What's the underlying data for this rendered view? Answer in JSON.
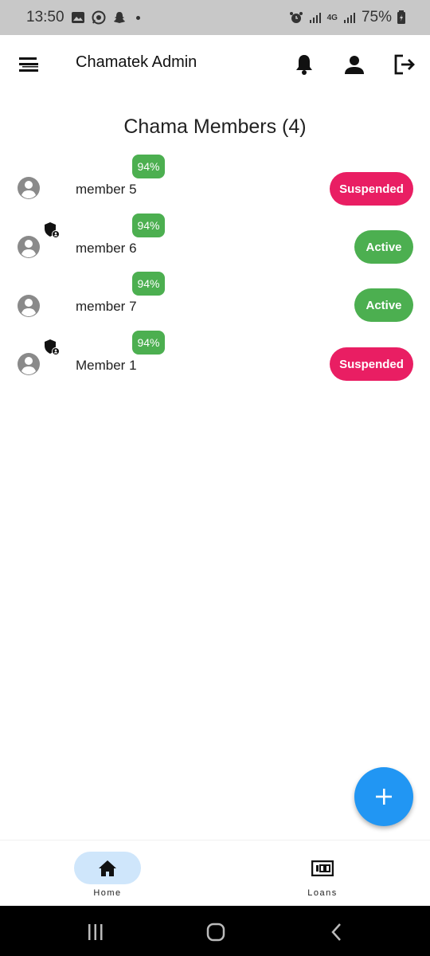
{
  "status_bar": {
    "time": "13:50",
    "battery": "75%",
    "network": "4G"
  },
  "app_bar": {
    "title": "Chamatek Admin",
    "actions": [
      "notifications-icon",
      "profile-icon",
      "logout-icon"
    ]
  },
  "page": {
    "heading": "Chama Members (4)"
  },
  "members": [
    {
      "name": "member 5",
      "score": "94%",
      "status": "Suspended",
      "is_admin": false
    },
    {
      "name": "member 6",
      "score": "94%",
      "status": "Active",
      "is_admin": true
    },
    {
      "name": "member 7",
      "score": "94%",
      "status": "Active",
      "is_admin": false
    },
    {
      "name": "Member 1",
      "score": "94%",
      "status": "Suspended",
      "is_admin": true
    }
  ],
  "fab": {
    "icon": "plus-icon"
  },
  "bottom_nav": [
    {
      "label": "Home",
      "icon": "home-icon",
      "selected": true
    },
    {
      "label": "Loans",
      "icon": "money-icon",
      "selected": false
    }
  ],
  "colors": {
    "active": "#4caf50",
    "suspended": "#e91e63",
    "score_badge": "#4caf50",
    "fab": "#2196f3",
    "nav_selected": "#cfe6fb",
    "status_bar_bg": "#c8c8c8"
  }
}
